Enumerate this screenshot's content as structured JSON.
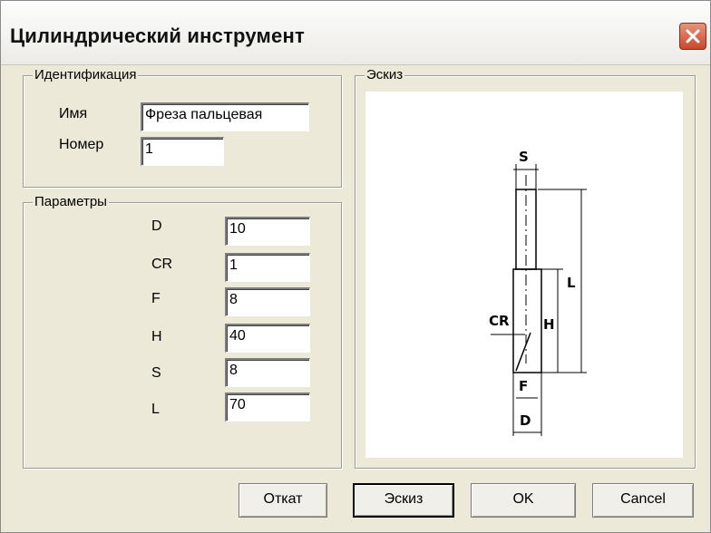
{
  "window": {
    "title": "Цилиндрический инструмент"
  },
  "identification": {
    "legend": "Идентификация",
    "name_label": "Имя",
    "name_value": "Фреза пальцевая",
    "number_label": "Номер",
    "number_value": "1"
  },
  "parameters": {
    "legend": "Параметры",
    "items": [
      {
        "label": "D",
        "value": "10"
      },
      {
        "label": "CR",
        "value": "1"
      },
      {
        "label": "F",
        "value": "8"
      },
      {
        "label": "H",
        "value": "40"
      },
      {
        "label": "S",
        "value": "8"
      },
      {
        "label": "L",
        "value": "70"
      }
    ]
  },
  "sketch": {
    "legend": "Эскиз",
    "labels": {
      "s": "S",
      "l": "L",
      "cr": "CR",
      "h": "H",
      "f": "F",
      "d": "D"
    }
  },
  "buttons": {
    "rollback": "Откат",
    "sketch": "Эскиз",
    "ok": "OK",
    "cancel": "Cancel"
  }
}
